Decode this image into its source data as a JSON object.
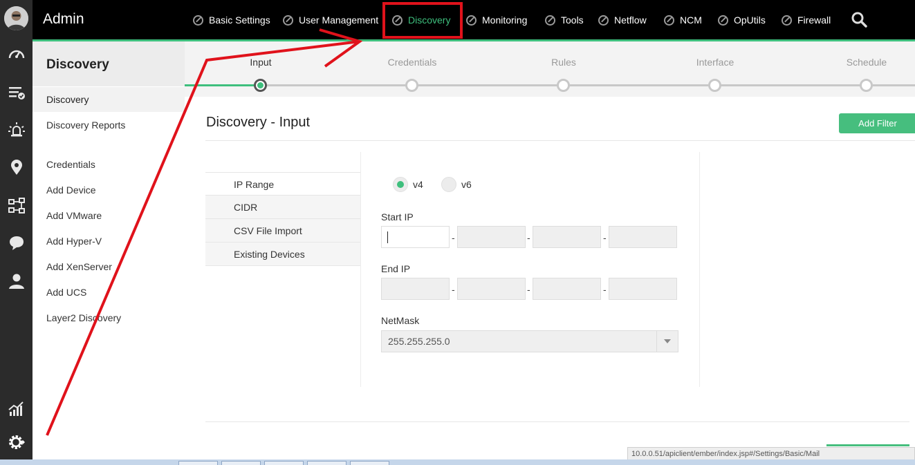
{
  "app": {
    "title": "Admin"
  },
  "topnav": {
    "items": [
      {
        "label": "Basic Settings"
      },
      {
        "label": "User Management"
      },
      {
        "label": "Discovery"
      },
      {
        "label": "Monitoring"
      },
      {
        "label": "Tools"
      },
      {
        "label": "Netflow"
      },
      {
        "label": "NCM"
      },
      {
        "label": "OpUtils"
      },
      {
        "label": "Firewall"
      }
    ],
    "active": "Discovery"
  },
  "rail": {
    "icons": [
      "avatar",
      "dashboard-gauge-icon",
      "alarms-list-icon",
      "alert-siren-icon",
      "map-pin-icon",
      "workflow-icon",
      "chat-icon",
      "user-icon",
      "reports-chart-icon",
      "settings-gear-icon"
    ]
  },
  "sidebar": {
    "title": "Discovery",
    "items": [
      {
        "label": "Discovery"
      },
      {
        "label": "Discovery Reports"
      },
      {
        "label": "Credentials"
      },
      {
        "label": "Add Device"
      },
      {
        "label": "Add VMware"
      },
      {
        "label": "Add Hyper-V"
      },
      {
        "label": "Add XenServer"
      },
      {
        "label": "Add UCS"
      },
      {
        "label": "Layer2 Discovery"
      }
    ]
  },
  "stepper": {
    "steps": [
      {
        "label": "Input"
      },
      {
        "label": "Credentials"
      },
      {
        "label": "Rules"
      },
      {
        "label": "Interface"
      },
      {
        "label": "Schedule"
      }
    ],
    "current": "Input"
  },
  "main": {
    "title": "Discovery - Input",
    "add_filter_label": "Add Filter",
    "method_tabs": [
      {
        "label": "IP Range"
      },
      {
        "label": "CIDR"
      },
      {
        "label": "CSV File Import"
      },
      {
        "label": "Existing Devices"
      }
    ],
    "selected_method": "IP Range",
    "ip_version": {
      "options": [
        {
          "label": "v4"
        },
        {
          "label": "v6"
        }
      ],
      "selected": "v4"
    },
    "start_ip": {
      "label": "Start IP",
      "octets": [
        "",
        "",
        "",
        ""
      ],
      "separator": "-"
    },
    "end_ip": {
      "label": "End IP",
      "octets": [
        "",
        "",
        "",
        ""
      ],
      "separator": "-"
    },
    "netmask": {
      "label": "NetMask",
      "value": "255.255.255.0"
    }
  },
  "status": {
    "url": "10.0.0.51/apiclient/ember/index.jsp#/Settings/Basic/Mail"
  },
  "colors": {
    "accent": "#3ebf7d",
    "annotation_red": "#e0121b",
    "topbar": "#000000",
    "rail": "#2b2b2b"
  }
}
